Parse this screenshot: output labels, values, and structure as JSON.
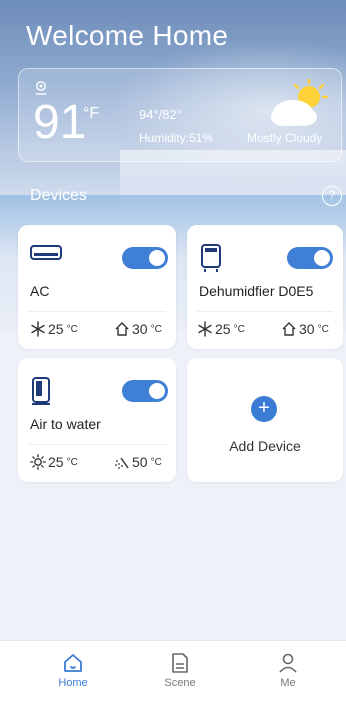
{
  "header": {
    "title": "Welcome Home"
  },
  "weather": {
    "temperature": "91",
    "unit": "°F",
    "high_low": "94°/82°",
    "humidity": "Humidity:51%",
    "condition": "Mostly Cloudy"
  },
  "devices": {
    "label": "Devices",
    "help_symbol": "?",
    "items": [
      {
        "name": "AC",
        "icon": "ac-unit-icon",
        "on": true,
        "stats": [
          {
            "icon": "snowflake-icon",
            "value": "25",
            "unit": "°C"
          },
          {
            "icon": "home-icon",
            "value": "30",
            "unit": "°C"
          }
        ]
      },
      {
        "name": "Dehumidfier D0E5",
        "icon": "dehumidifier-icon",
        "on": true,
        "stats": [
          {
            "icon": "snowflake-icon",
            "value": "25",
            "unit": "°C"
          },
          {
            "icon": "home-icon",
            "value": "30",
            "unit": "°C"
          }
        ]
      },
      {
        "name": "Air to water",
        "icon": "heat-pump-icon",
        "on": true,
        "stats": [
          {
            "icon": "sun-icon",
            "value": "25",
            "unit": "°C"
          },
          {
            "icon": "shower-icon",
            "value": "50",
            "unit": "°C"
          }
        ]
      }
    ],
    "add": {
      "label": "Add Device",
      "symbol": "+"
    }
  },
  "tabbar": {
    "tabs": [
      {
        "label": "Home",
        "icon": "home-icon",
        "active": true
      },
      {
        "label": "Scene",
        "icon": "scene-icon",
        "active": false
      },
      {
        "label": "Me",
        "icon": "user-icon",
        "active": false
      }
    ]
  },
  "colors": {
    "accent": "#3a7bd5",
    "toggle_on": "#3f7fd6"
  }
}
